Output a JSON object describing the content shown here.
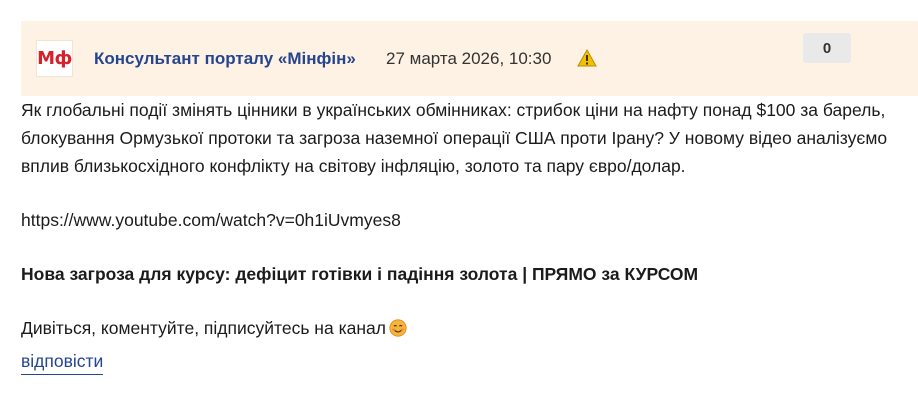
{
  "comment": {
    "avatar_text": "Мф",
    "author": "Консультант порталу «Мінфін»",
    "datetime": "27 марта 2026, 10:30",
    "warning_icon": "warning-triangle-icon",
    "rating": "0",
    "paragraph_lines": [
      "Як глобальні події змінять цінники в українських обмінниках: стрибок ціни на нафту понад $100 за барель,",
      "блокування Ормузької протоки та загроза наземної операції США проти Ірану? У новому відео аналізуємо",
      "вплив близькосхідного конфлікту на світову інфляцію, золото та пару євро/долар."
    ],
    "link": "https://www.youtube.com/watch?v=0h1iUvmyes8",
    "video_title": "Нова загроза для курсу: дефіцит готівки і падіння золота | ПРЯМО за КУРСОМ",
    "call_to_action": "Дивіться, коментуйте, підписуйтесь на канал",
    "emoji_icon": "smiling-face-icon",
    "reply_label": "відповісти"
  },
  "colors": {
    "header_bg": "#fdf2e3",
    "author": "#26458f",
    "avatar_text": "#d8202b",
    "warning": "#f2c200"
  }
}
